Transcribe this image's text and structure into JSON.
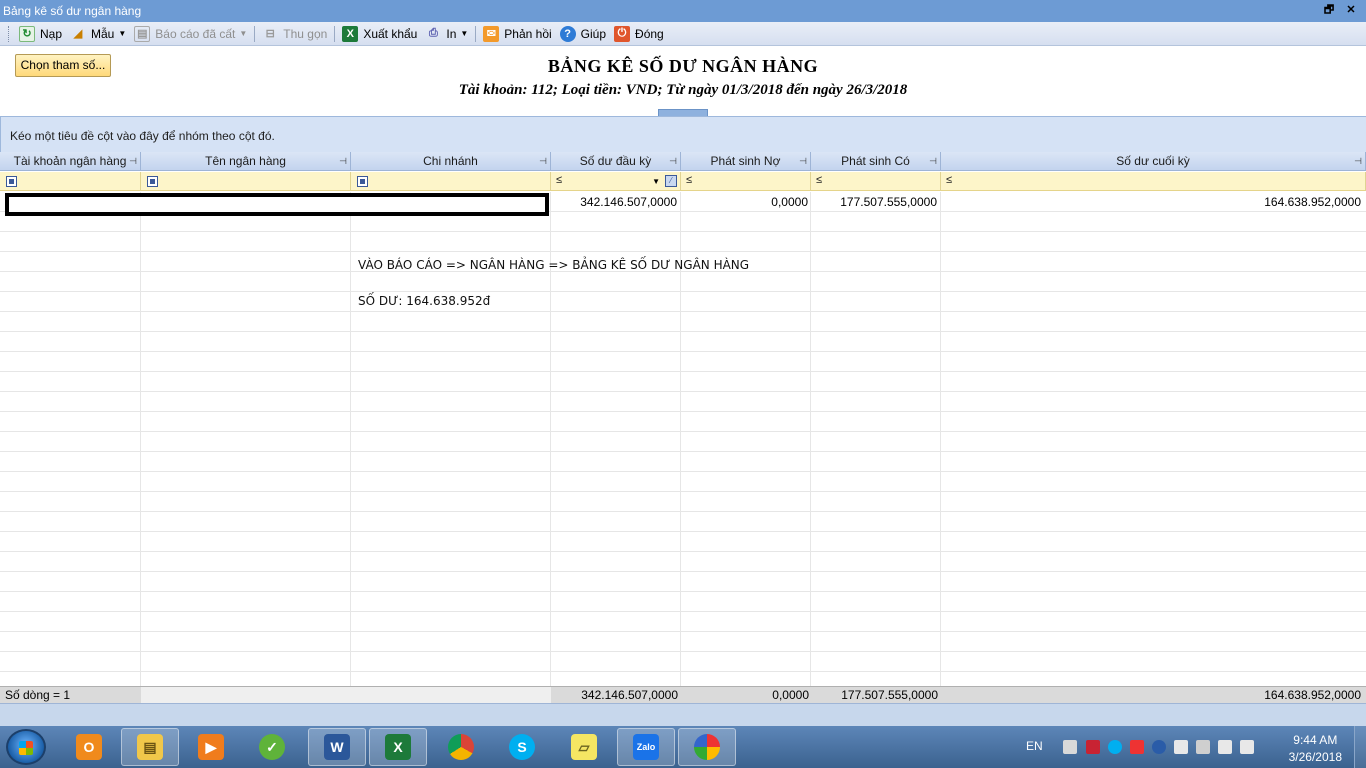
{
  "window": {
    "title": "Bảng kê số dư ngân hàng",
    "restore_glyph": "🗗",
    "close_glyph": "✕"
  },
  "toolbar": {
    "items": [
      {
        "label": "Nạp",
        "icon": "refresh-icon",
        "enabled": true
      },
      {
        "label": "Mẫu",
        "icon": "template-icon",
        "enabled": true
      },
      {
        "label": "Báo cáo đã cất",
        "icon": "saved-report-icon",
        "enabled": false
      },
      {
        "label": "Thu gọn",
        "icon": "collapse-icon",
        "enabled": false
      },
      {
        "label": "Xuất khẩu",
        "icon": "excel-icon",
        "enabled": true
      },
      {
        "label": "In",
        "icon": "print-icon",
        "enabled": true
      },
      {
        "label": "Phản hồi",
        "icon": "mail-icon",
        "enabled": true
      },
      {
        "label": "Giúp",
        "icon": "help-icon",
        "enabled": true
      },
      {
        "label": "Đóng",
        "icon": "power-icon",
        "enabled": true
      }
    ]
  },
  "header": {
    "param_button": "Chọn tham số...",
    "title": "BẢNG KÊ SỐ DƯ NGÂN HÀNG",
    "subtitle": "Tài khoản: 112; Loại tiền: VND; Từ ngày 01/3/2018 đến ngày 26/3/2018"
  },
  "group_panel": {
    "hint": "Kéo một tiêu đề cột vào đây để nhóm theo cột đó."
  },
  "grid": {
    "columns": [
      "Tài khoản ngân hàng",
      "Tên ngân hàng",
      "Chi nhánh",
      "Số dư đầu kỳ",
      "Phát sinh Nợ",
      "Phát sinh Có",
      "Số dư cuối kỳ"
    ],
    "filter_operator": "≤",
    "rows": [
      {
        "account": "",
        "bank": "",
        "branch": "",
        "opening": "342.146.507,0000",
        "debit": "0,0000",
        "credit": "177.507.555,0000",
        "closing": "164.638.952,0000"
      }
    ],
    "footer": {
      "count": "Số dòng = 1",
      "opening": "342.146.507,0000",
      "debit": "0,0000",
      "credit": "177.507.555,0000",
      "closing": "164.638.952,0000"
    }
  },
  "annotations": {
    "line1": "VÀO BÁO CÁO => NGÂN HÀNG => BẢNG KÊ SỐ DƯ NGÂN HÀNG",
    "line2": "SỐ DƯ: 164.638.952đ"
  },
  "taskbar": {
    "apps": [
      "outlook-icon",
      "file-explorer-icon",
      "media-player-icon",
      "coc-coc-icon",
      "word-icon",
      "excel-icon",
      "chrome-icon",
      "skype-icon",
      "sticky-notes-icon",
      "zalo-icon",
      "picasa-icon"
    ],
    "zalo_label": "Zalo",
    "tray_lang": "EN",
    "time": "9:44 AM",
    "date": "3/26/2018"
  },
  "colors": {
    "accent": "#6d9bd4",
    "filter_row": "#fdf5c9",
    "group_panel": "#d5e2f5"
  }
}
